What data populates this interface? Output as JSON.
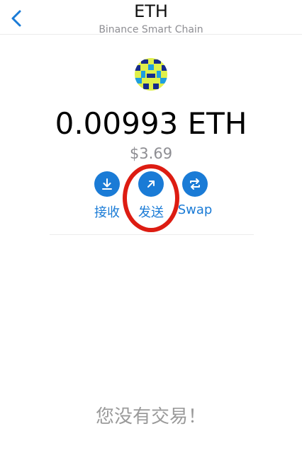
{
  "header": {
    "title": "ETH",
    "subtitle": "Binance Smart Chain",
    "back_icon": "chevron-left-icon"
  },
  "token": {
    "avatar_icon": "identicon",
    "balance": "0.00993 ETH",
    "fiat_value": "$3.69"
  },
  "actions": [
    {
      "label": "接收",
      "icon": "download-arrow-icon"
    },
    {
      "label": "发送",
      "icon": "arrow-up-right-icon"
    },
    {
      "label": "Swap",
      "icon": "swap-arrows-icon"
    }
  ],
  "transactions": {
    "empty_message": "您没有交易！"
  },
  "colors": {
    "accent": "#1a7bd6",
    "annotation": "#dd1c12",
    "muted_text": "#8e8e93"
  }
}
